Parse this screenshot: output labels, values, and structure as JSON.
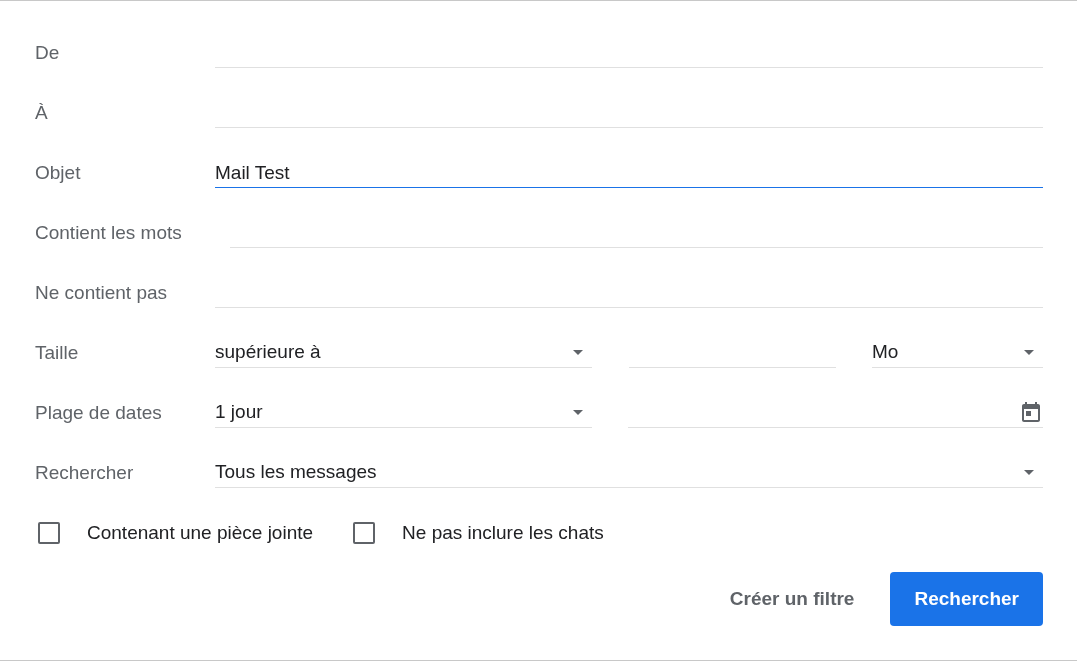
{
  "rows": [
    {
      "label": "De",
      "controls": [
        {
          "kind": "text",
          "focused": false
        }
      ]
    },
    {
      "label": "À",
      "controls": [
        {
          "kind": "text",
          "focused": false
        }
      ]
    },
    {
      "label": "Objet",
      "controls": [
        {
          "kind": "text",
          "value": "Mail Test",
          "focused": true
        }
      ]
    },
    {
      "label": "Contient les mots",
      "controls": [
        {
          "kind": "text",
          "focused": false
        }
      ]
    },
    {
      "label": "Ne contient pas",
      "controls": [
        {
          "kind": "text",
          "focused": false
        }
      ]
    },
    {
      "label": "Taille",
      "controls": [
        {
          "kind": "select",
          "value": "supérieure à"
        },
        {
          "kind": "text",
          "focused": false
        },
        {
          "kind": "select",
          "value": "Mo"
        }
      ]
    },
    {
      "label": "Plage de dates",
      "controls": [
        {
          "kind": "select",
          "value": "1 jour"
        },
        {
          "kind": "date"
        }
      ]
    },
    {
      "label": "Rechercher",
      "controls": [
        {
          "kind": "select",
          "value": "Tous les messages"
        }
      ]
    }
  ],
  "checkboxes": [
    {
      "label": "Contenant une pièce jointe",
      "checked": false
    },
    {
      "label": "Ne pas inclure les chats",
      "checked": false
    }
  ],
  "buttons": [
    {
      "label": "Créer un filtre",
      "kind": "text"
    },
    {
      "label": "Rechercher",
      "kind": "primary"
    }
  ]
}
